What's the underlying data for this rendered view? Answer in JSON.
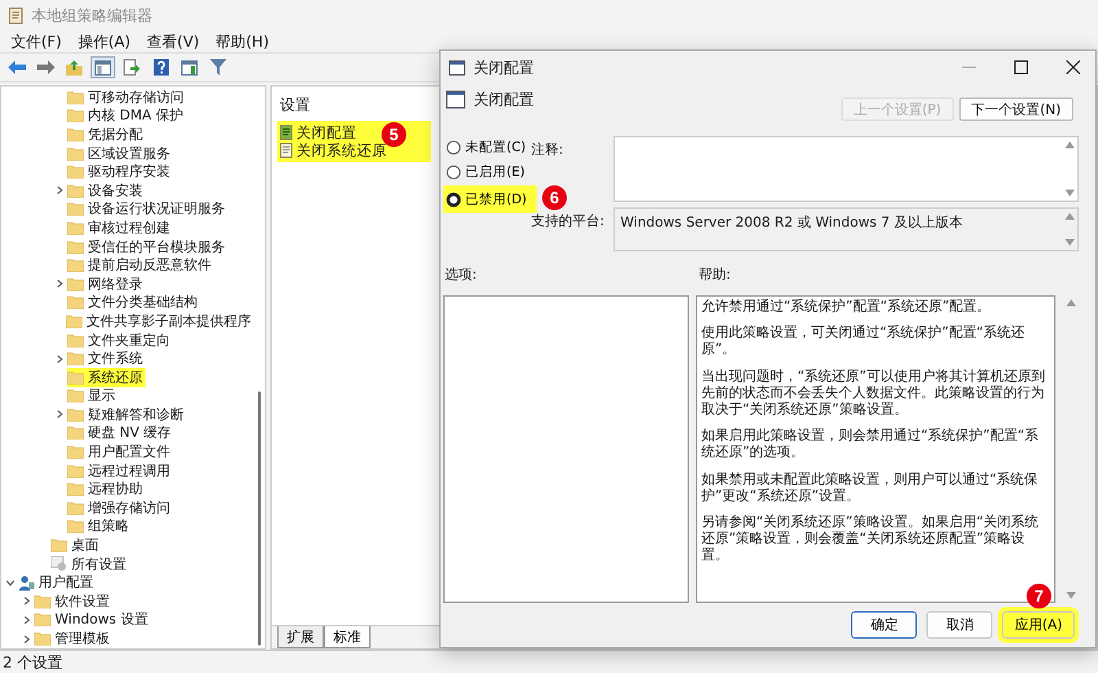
{
  "window": {
    "title": "本地组策略编辑器"
  },
  "menu": [
    "文件(F)",
    "操作(A)",
    "查看(V)",
    "帮助(H)"
  ],
  "toolbar": [
    {
      "kind": "back",
      "pressed": false
    },
    {
      "kind": "forward",
      "pressed": false
    },
    {
      "kind": "up",
      "pressed": false
    },
    {
      "kind": "tree",
      "pressed": true
    },
    {
      "kind": "export",
      "pressed": false
    },
    {
      "kind": "help",
      "pressed": false
    },
    {
      "kind": "panel",
      "pressed": false
    },
    {
      "kind": "filter",
      "pressed": false
    }
  ],
  "tree": {
    "items": [
      {
        "children": [
          {
            "children": [
              {
                "children": [
                  {
                    "label": "可移动存储访问",
                    "selected": false
                  },
                  {
                    "label": "内核 DMA 保护",
                    "selected": false
                  },
                  {
                    "label": "凭据分配",
                    "selected": false
                  },
                  {
                    "label": "区域设置服务",
                    "selected": false
                  },
                  {
                    "label": "驱动程序安装",
                    "selected": false
                  },
                  {
                    "label": "设备安装",
                    "selected": false,
                    "expanded": false
                  },
                  {
                    "label": "设备运行状况证明服务",
                    "selected": false
                  },
                  {
                    "label": "审核过程创建",
                    "selected": false
                  },
                  {
                    "label": "受信任的平台模块服务",
                    "selected": false
                  },
                  {
                    "label": "提前启动反恶意软件",
                    "selected": false
                  },
                  {
                    "label": "网络登录",
                    "selected": false,
                    "expanded": false
                  },
                  {
                    "label": "文件分类基础结构",
                    "selected": false
                  },
                  {
                    "label": "文件共享影子副本提供程序",
                    "selected": false
                  },
                  {
                    "label": "文件夹重定向",
                    "selected": false
                  },
                  {
                    "label": "文件系统",
                    "selected": false,
                    "expanded": false
                  },
                  {
                    "label": "系统还原",
                    "selected": true
                  },
                  {
                    "label": "显示",
                    "selected": false
                  },
                  {
                    "label": "疑难解答和诊断",
                    "selected": false,
                    "expanded": false
                  },
                  {
                    "label": "硬盘 NV 缓存",
                    "selected": false
                  },
                  {
                    "label": "用户配置文件",
                    "selected": false
                  },
                  {
                    "label": "远程过程调用",
                    "selected": false
                  },
                  {
                    "label": "远程协助",
                    "selected": false
                  },
                  {
                    "label": "增强存储访问",
                    "selected": false
                  },
                  {
                    "label": "组策略",
                    "selected": false
                  }
                ]
              },
              {
                "label": "桌面",
                "selected": false
              },
              {
                "label": "所有设置",
                "selected": false,
                "kind": "settings"
              }
            ]
          }
        ]
      },
      {
        "label": "用户配置",
        "selected": false,
        "kind": "user",
        "expanded": true,
        "children": [
          {
            "label": "软件设置",
            "selected": false,
            "expanded": false
          },
          {
            "label": "Windows 设置",
            "selected": false,
            "expanded": false
          },
          {
            "label": "管理模板",
            "selected": false,
            "expanded": false
          }
        ]
      }
    ]
  },
  "settings_list": {
    "header": "设置",
    "highlighted": true,
    "callout": "5",
    "items": [
      {
        "label": "关闭配置",
        "kind": "configured"
      },
      {
        "label": "关闭系统还原",
        "kind": "plain"
      }
    ]
  },
  "bottom_tabs": [
    {
      "label": "扩展",
      "selected": false
    },
    {
      "label": "标准",
      "selected": true
    }
  ],
  "status_bar": "2 个设置",
  "dialog": {
    "title": "关闭配置",
    "setting_name": "关闭配置",
    "nav_buttons": [
      {
        "label": "上一个设置(P)",
        "disabled": true
      },
      {
        "label": "下一个设置(N)",
        "disabled": false
      }
    ],
    "states": [
      {
        "label": "未配置(C)",
        "selected": false
      },
      {
        "label": "已启用(E)",
        "selected": false
      },
      {
        "label": "已禁用(D)",
        "selected": true
      }
    ],
    "states_highlighted": true,
    "states_callout": "6",
    "comment_label": "注释:",
    "platform_label": "支持的平台:",
    "platform": "Windows Server 2008 R2 或 Windows 7 及以上版本",
    "options_label": "选项:",
    "help_label": "帮助:",
    "help": [
      "允许禁用通过“系统保护”配置“系统还原”配置。",
      "使用此策略设置，可关闭通过“系统保护”配置“系统还原”。",
      "当出现问题时，“系统还原”可以使用户将其计算机还原到先前的状态而不会丢失个人数据文件。此策略设置的行为取决于“关闭系统还原”策略设置。",
      "如果启用此策略设置，则会禁用通过“系统保护”配置“系统还原”的选项。",
      "如果禁用或未配置此策略设置，则用户可以通过“系统保护”更改“系统还原”设置。",
      "另请参阅“关闭系统还原”策略设置。如果启用“关闭系统还原”策略设置，则会覆盖“关闭系统还原配置”策略设置。"
    ],
    "buttons": [
      {
        "label": "确定",
        "default": true,
        "highlighted": false
      },
      {
        "label": "取消",
        "default": false,
        "highlighted": false
      },
      {
        "label": "应用(A)",
        "default": false,
        "highlighted": true,
        "callout": "7"
      }
    ]
  }
}
